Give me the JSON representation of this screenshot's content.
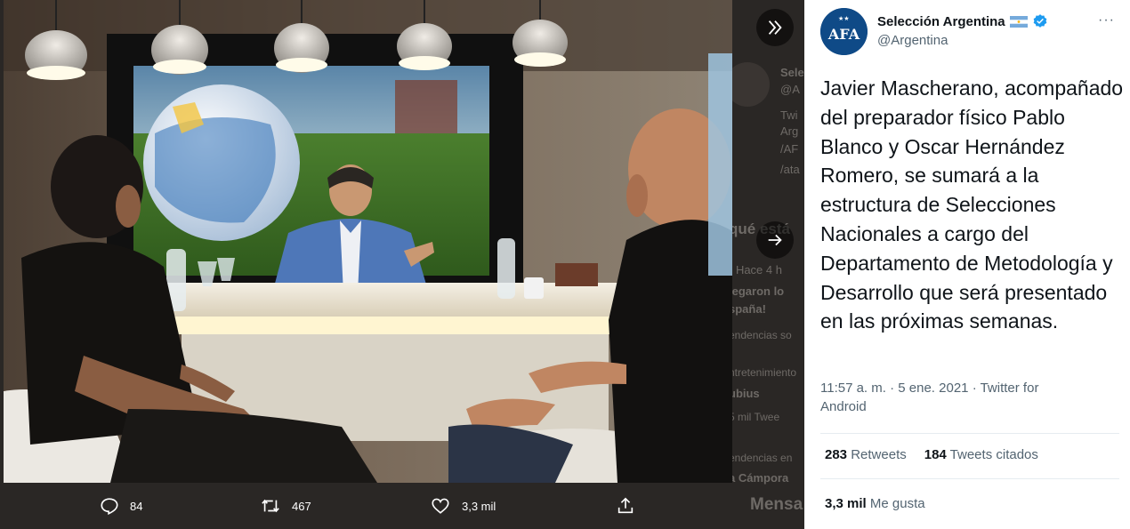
{
  "tweet": {
    "author_name": "Selección Argentina",
    "author_handle": "@Argentina",
    "text": "Javier Mascherano, acompañado del preparador físico Pablo Blanco y Oscar Hernández Romero, se sumará a la estructura de Selecciones Nacionales a cargo del Departamento de Metodología y Desarrollo que será presentado en las próximas semanas.",
    "timestamp": "11:57 a. m. · 5 ene. 2021",
    "source": "Twitter for Android",
    "retweets_count": "283",
    "retweets_label": "Retweets",
    "quotes_count": "184",
    "quotes_label": "Tweets citados",
    "likes_count": "3,3 mil",
    "likes_label": "Me gusta",
    "more_options": "···"
  },
  "media_actions": {
    "reply_count": "84",
    "retweet_count": "467",
    "like_count": "3,3 mil"
  },
  "background_timeline": {
    "lines": [
      "Sele",
      "@A",
      "Twi",
      "Arg",
      "/AF",
      "/ata",
      "qué está",
      "· Hace 4 h",
      "legaron lo",
      "spaña!",
      "endencias so",
      "ntretenimiento",
      "ubius",
      "5 mil Twee",
      "endencias en",
      "a Cámpora",
      "Mensa"
    ]
  },
  "icons": {
    "collapse": "double-chevron-right-icon",
    "next": "arrow-right-icon",
    "reply": "reply-icon",
    "retweet": "retweet-icon",
    "like": "heart-icon",
    "share": "share-icon",
    "verified": "verified-badge-icon",
    "flag": "argentina-flag-icon"
  },
  "colors": {
    "brand_blue": "#1d9bf0",
    "afa_blue": "#0f4a87",
    "text_primary": "#0f1419",
    "text_secondary": "#536471",
    "flag_blue": "#75aadb"
  }
}
